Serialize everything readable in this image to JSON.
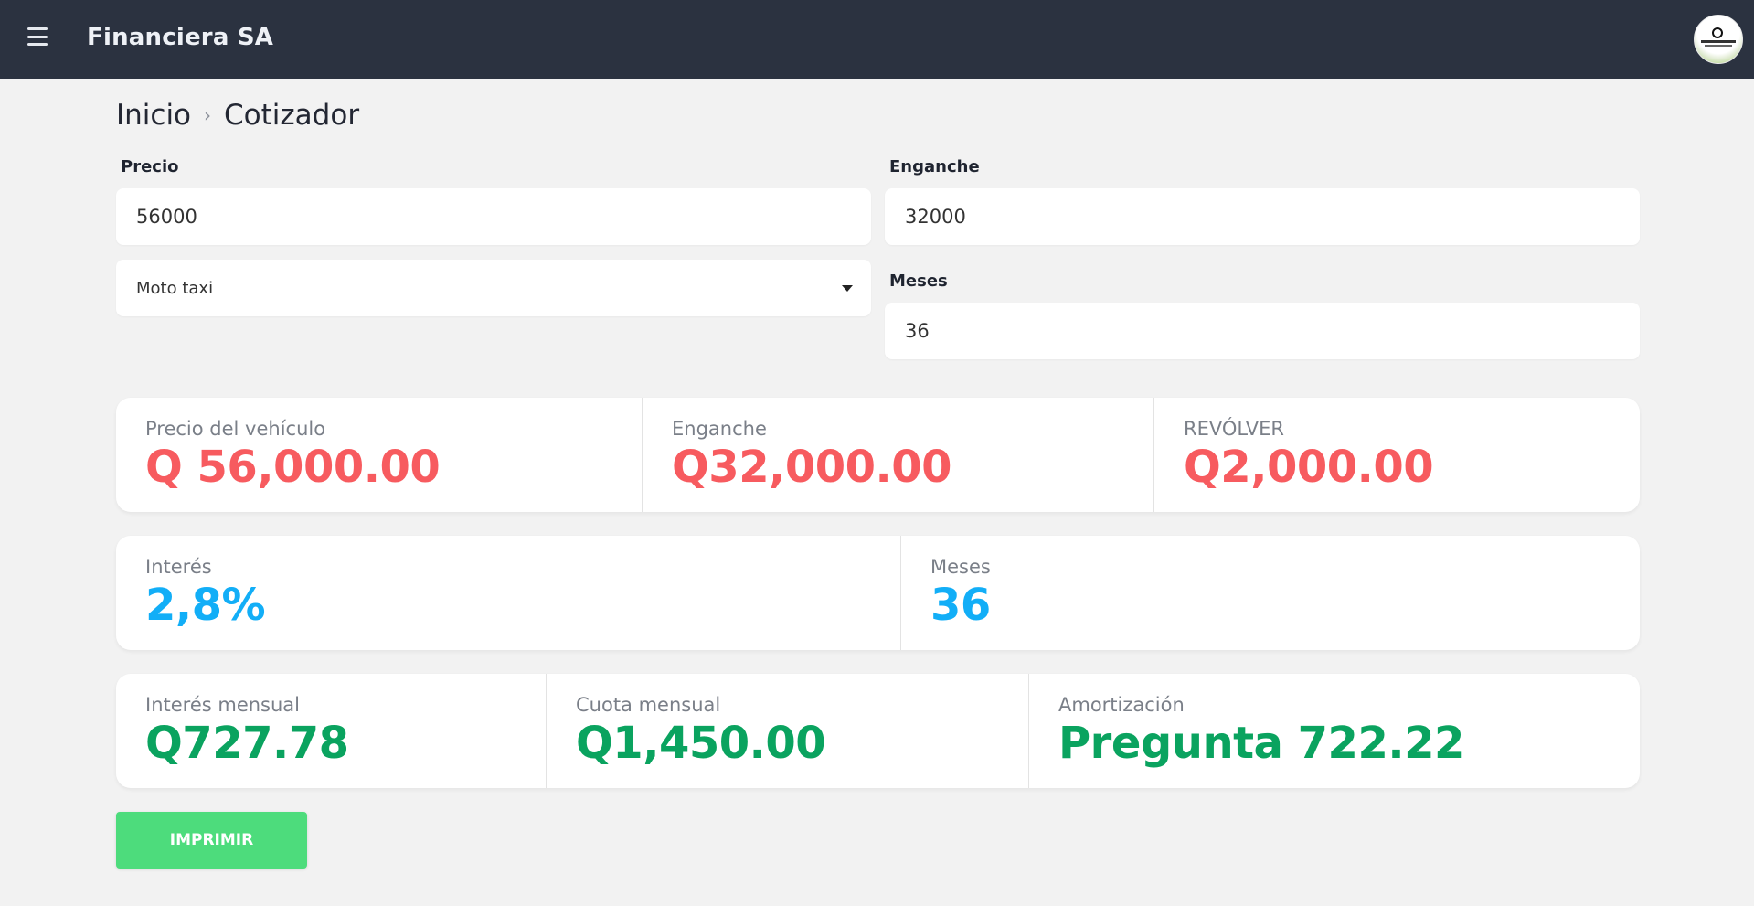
{
  "app": {
    "title": "Financiera SA"
  },
  "breadcrumb": {
    "home": "Inicio",
    "current": "Cotizador"
  },
  "form": {
    "precio_label": "Precio",
    "precio_value": "56000",
    "enganche_label": "Enganche",
    "enganche_value": "32000",
    "tipo_value": "Moto taxi",
    "meses_label": "Meses",
    "meses_value": "36"
  },
  "summary": {
    "precio_label": "Precio del vehículo",
    "precio_value": "Q 56,000.00",
    "enganche_label": "Enganche",
    "enganche_value": "Q32,000.00",
    "revolver_label": "REVÓLVER",
    "revolver_value": "Q2,000.00",
    "interes_label": "Interés",
    "interes_value": "2,8%",
    "meses_label": "Meses",
    "meses_value": "36",
    "interes_mensual_label": "Interés mensual",
    "interes_mensual_value": "Q727.78",
    "cuota_label": "Cuota mensual",
    "cuota_value": "Q1,450.00",
    "amortizacion_label": "Amortización",
    "amortizacion_value": "Pregunta 722.22"
  },
  "actions": {
    "print_label": "IMPRIMIR"
  },
  "colors": {
    "topbar": "#2b3240",
    "red": "#f75b5f",
    "blue": "#12aef7",
    "green": "#0aa35f",
    "button": "#4ddc7c"
  }
}
